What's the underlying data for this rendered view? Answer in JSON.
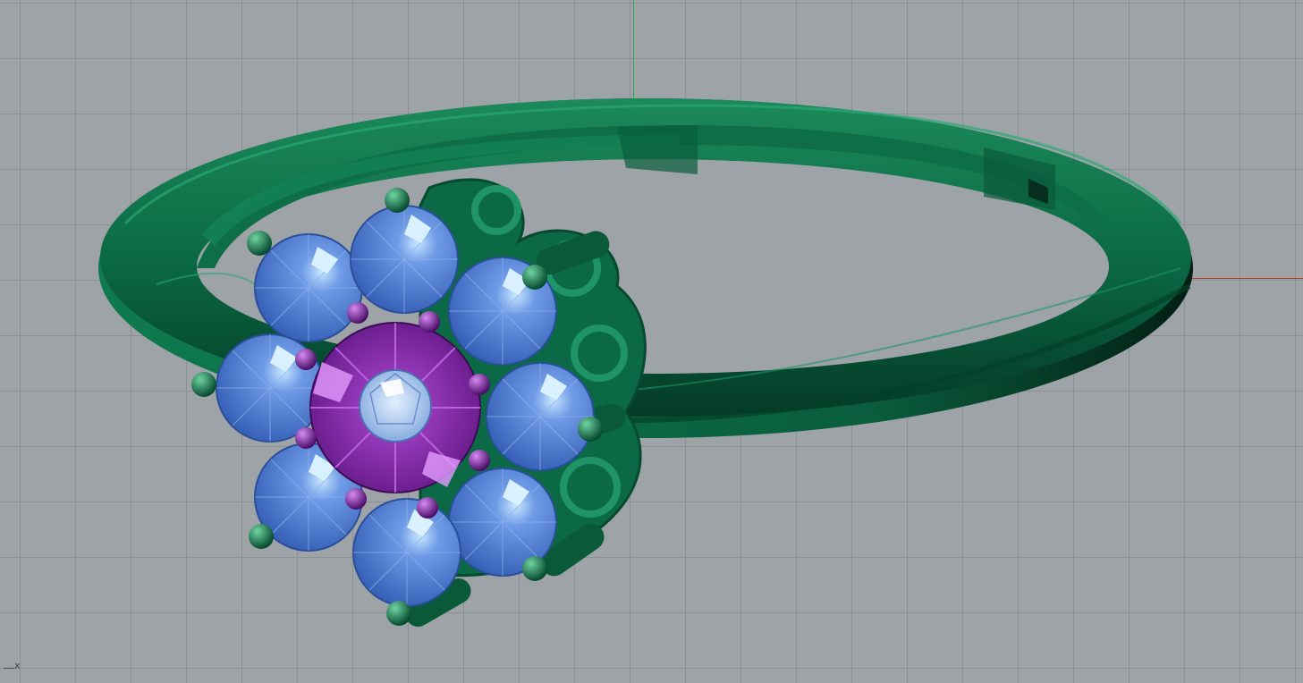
{
  "viewport": {
    "corner_axis_label": "x",
    "colors": {
      "background": "#9ea3a7",
      "grid_line": "#8b9095",
      "axis_x": "#c0392b",
      "axis_y": "#2ea84a",
      "ring_metal": "#0b6a45",
      "outer_gems": "#4f7ed6",
      "center_halo": "#8e2bb8",
      "center_stone": "#a9c8ef"
    },
    "model": {
      "object_name": "flower-ring",
      "outer_stone_count": 8,
      "halo_prong_count": 10
    }
  }
}
